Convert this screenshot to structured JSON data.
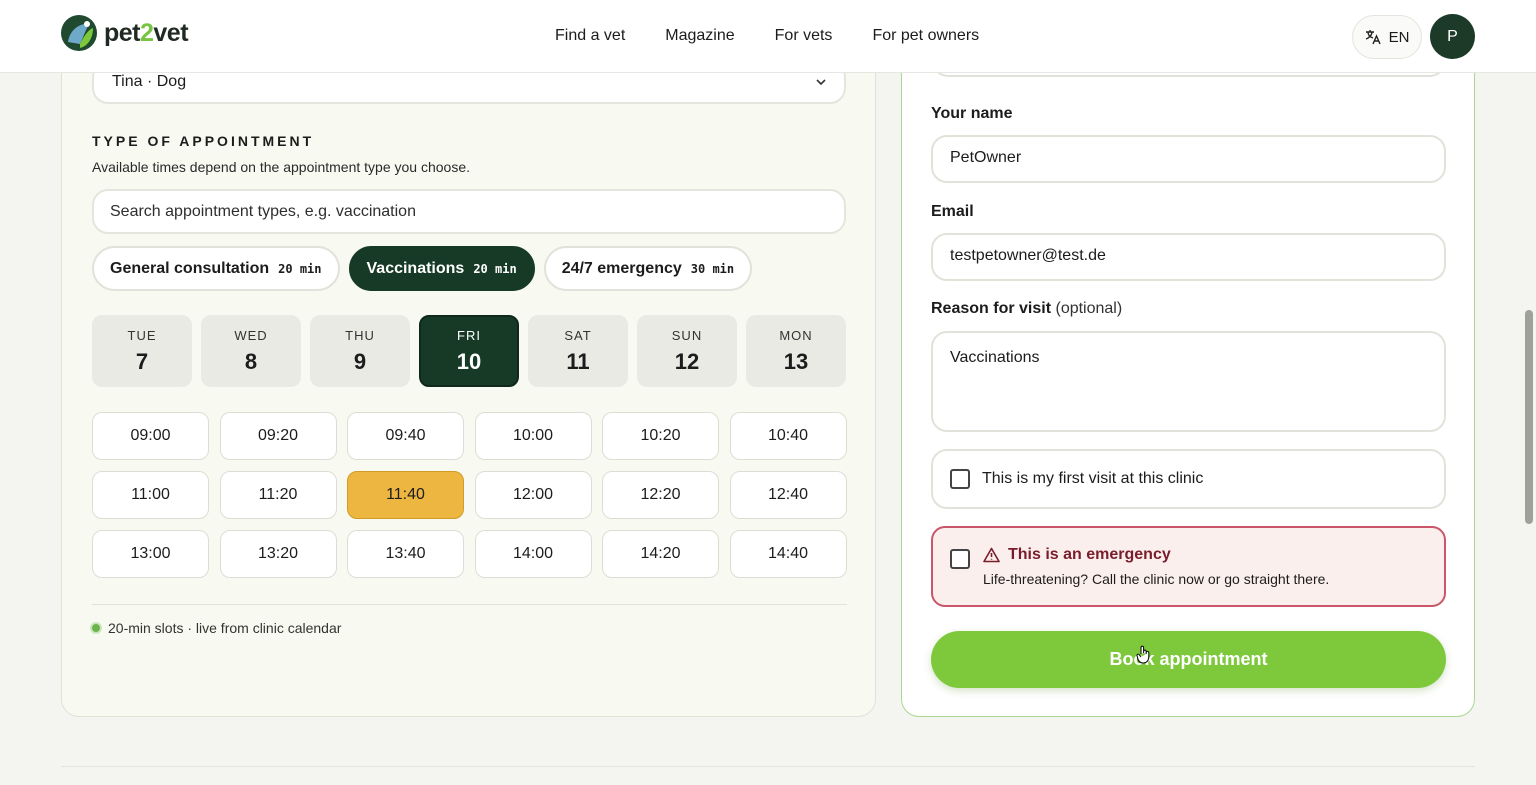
{
  "header": {
    "logo": {
      "text_part1": "pet",
      "text_part2": "2",
      "text_part3": "vet"
    },
    "nav": [
      "Find a vet",
      "Magazine",
      "For vets",
      "For pet owners"
    ],
    "language": "EN",
    "avatar_initial": "P"
  },
  "booking": {
    "pet_value": "Tina · Dog",
    "type_section": {
      "title": "TYPE OF APPOINTMENT",
      "subtitle": "Available times depend on the appointment type you choose.",
      "search_placeholder": "Search appointment types, e.g. vaccination",
      "types": [
        {
          "label": "General consultation",
          "duration": "20 min",
          "active": false
        },
        {
          "label": "Vaccinations",
          "duration": "20 min",
          "active": true
        },
        {
          "label": "24/7 emergency",
          "duration": "30 min",
          "active": false
        }
      ]
    },
    "days": [
      {
        "name": "TUE",
        "num": "7"
      },
      {
        "name": "WED",
        "num": "8"
      },
      {
        "name": "THU",
        "num": "9"
      },
      {
        "name": "FRI",
        "num": "10",
        "active": true
      },
      {
        "name": "SAT",
        "num": "11"
      },
      {
        "name": "SUN",
        "num": "12"
      },
      {
        "name": "MON",
        "num": "13"
      }
    ],
    "slots": [
      "09:00",
      "09:20",
      "09:40",
      "10:00",
      "10:20",
      "10:40",
      "11:00",
      "11:20",
      "11:40",
      "12:00",
      "12:20",
      "12:40",
      "13:00",
      "13:20",
      "13:40",
      "14:00",
      "14:20",
      "14:40"
    ],
    "selected_slot": "11:40",
    "live_note": "20-min slots · live from clinic calendar"
  },
  "form": {
    "name_label": "Your name",
    "name_value": "PetOwner",
    "email_label": "Email",
    "email_value": "testpetowner@test.de",
    "reason_label": "Reason for visit",
    "reason_optional": "(optional)",
    "reason_value": "Vaccinations",
    "first_visit_label": "This is my first visit at this clinic",
    "emergency_title": "This is an emergency",
    "emergency_sub": "Life-threatening? Call the clinic now or go straight there.",
    "book_button": "Book appointment"
  },
  "colors": {
    "brand_dark": "#173a26",
    "brand_green": "#7ec93b",
    "slot_selected": "#ecb640",
    "emergency_border": "#c9566a"
  }
}
